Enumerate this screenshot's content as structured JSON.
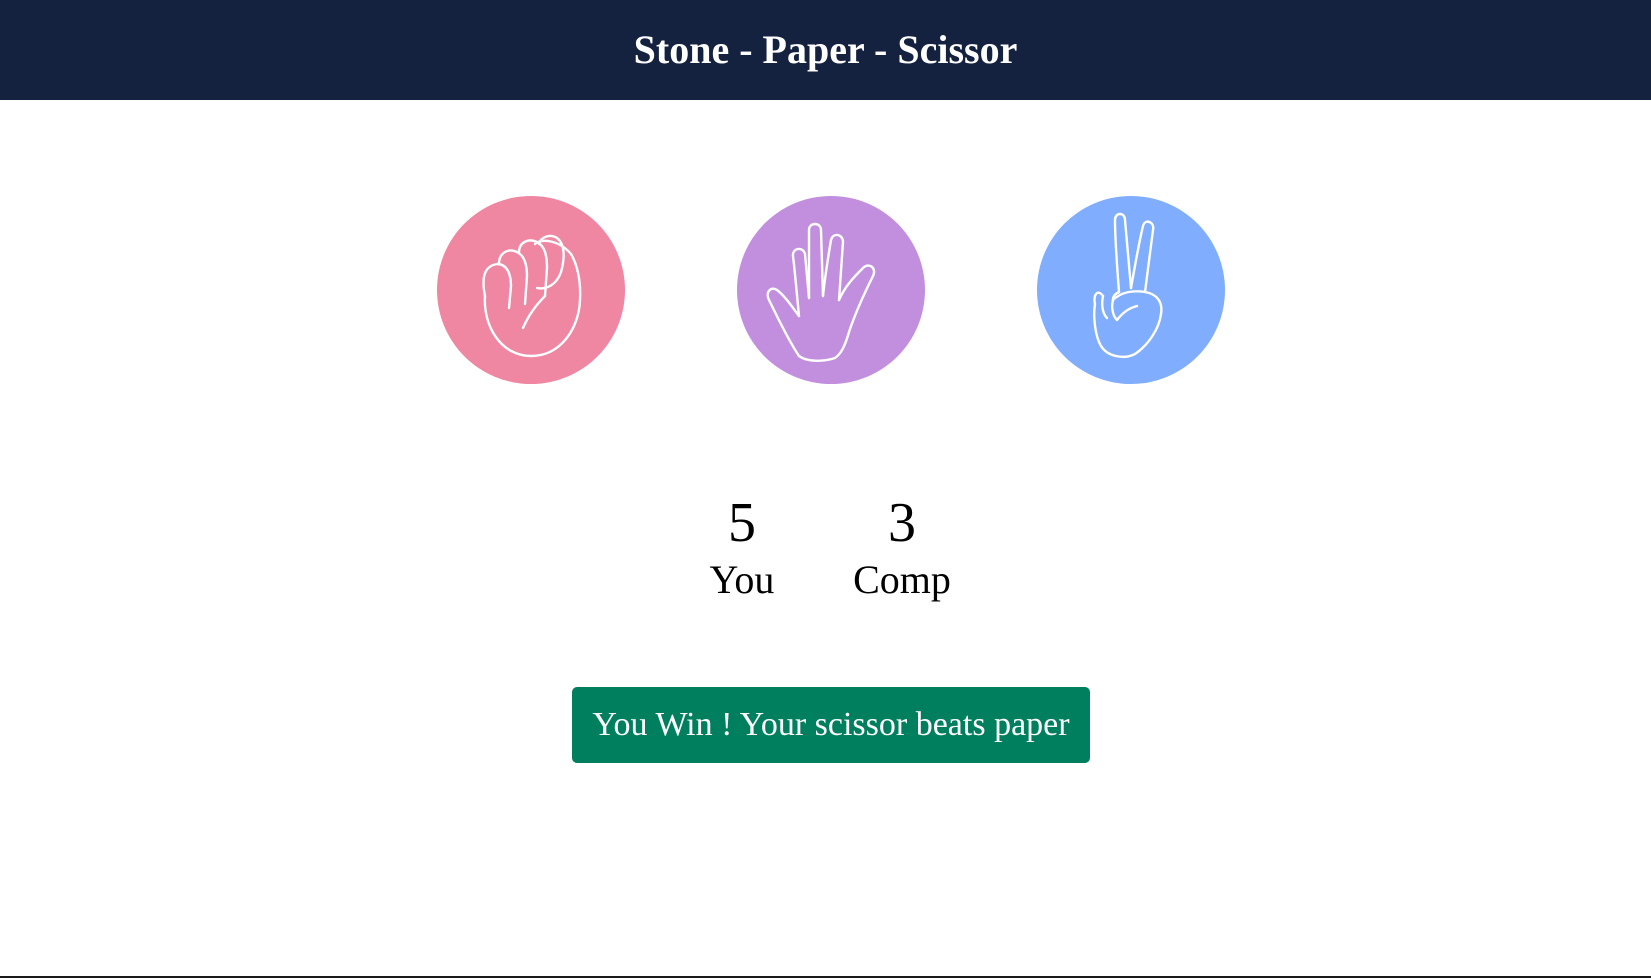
{
  "header": {
    "title": "Stone - Paper - Scissor"
  },
  "choices": [
    {
      "id": "stone",
      "icon": "fist-icon",
      "color": "#ef86a2"
    },
    {
      "id": "paper",
      "icon": "open-hand-icon",
      "color": "#c28fdf"
    },
    {
      "id": "scissor",
      "icon": "victory-hand-icon",
      "color": "#80adfe"
    }
  ],
  "scoreboard": {
    "user_score": "5",
    "user_label": "You",
    "comp_score": "3",
    "comp_label": "Comp"
  },
  "message": {
    "text": "You Win ! Your scissor beats paper",
    "color": "#007f5f"
  },
  "colors": {
    "header_bg": "#14223f"
  }
}
